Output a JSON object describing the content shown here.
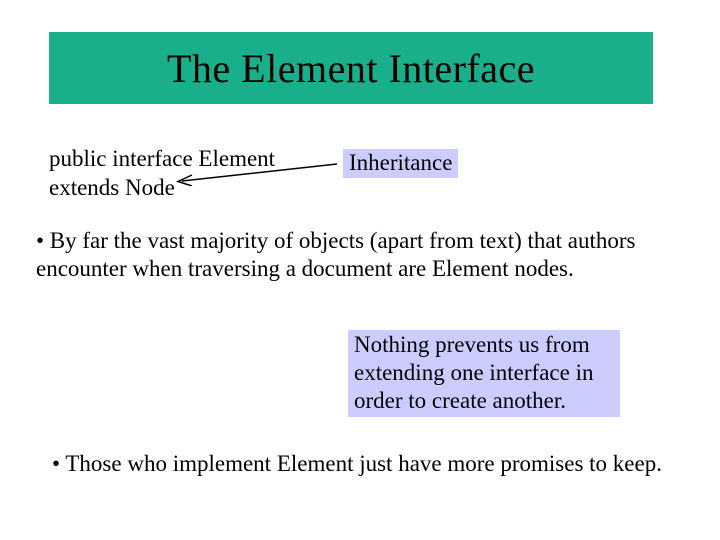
{
  "title": "The Element Interface",
  "code": {
    "line1": "public interface Element",
    "line2": "extends Node"
  },
  "inheritance_label": "Inheritance",
  "bullet1": "• By far the vast majority of objects (apart from text) that authors encounter when traversing a document are Element nodes.",
  "note": "Nothing prevents us from extending one interface in order to create another.",
  "bullet2": "• Those who implement Element just have more promises to keep.",
  "colors": {
    "title_bg": "#19af8b",
    "highlight_bg": "#ccccff"
  }
}
